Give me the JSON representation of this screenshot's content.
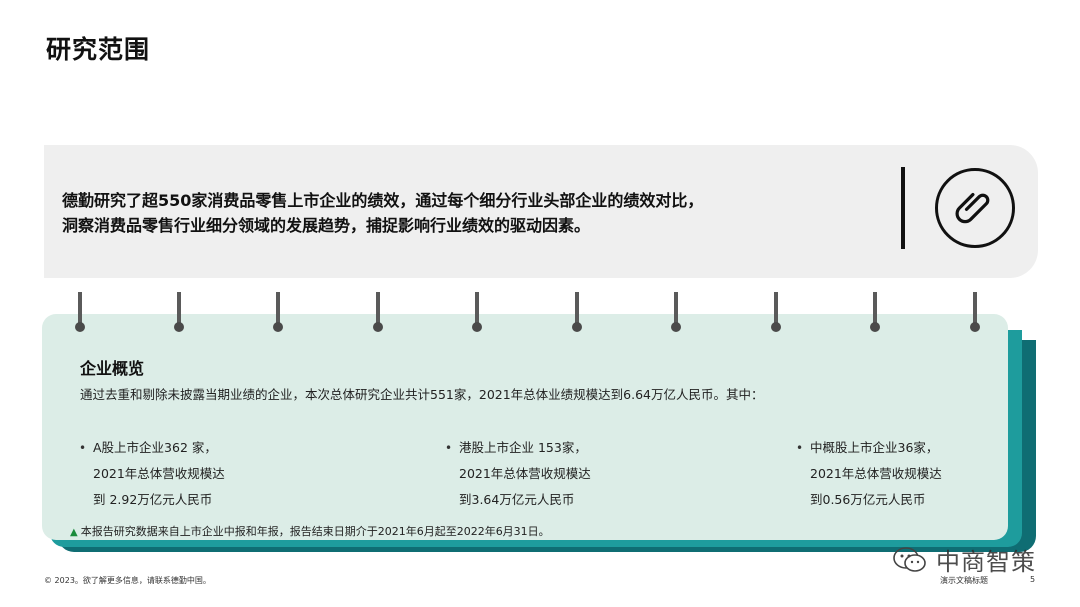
{
  "page": {
    "title": "研究范围"
  },
  "summary": {
    "line1": "德勤研究了超550家消费品零售上市企业的绩效，通过每个细分行业头部企业的绩效对比，",
    "line2": "洞察消费品零售行业细分领域的发展趋势，捕捉影响行业绩效的驱动因素。",
    "icon": "paperclip-icon"
  },
  "overview": {
    "title": "企业概览",
    "description": "通过去重和剔除未披露当期业绩的企业，本次总体研究企业共计551家，2021年总体业绩规模达到6.64万亿人民币。其中：",
    "columns": [
      {
        "bullet": "•",
        "line1": "A股上市企业362 家，",
        "line2": "2021年总体营收规模达",
        "line3": "到 2.92万亿元人民币"
      },
      {
        "bullet": "•",
        "line1": "港股上市企业 153家，",
        "line2": "2021年总体营收规模达",
        "line3": "到3.64万亿元人民币"
      },
      {
        "bullet": "•",
        "line1": "中概股上市企业36家，",
        "line2": "2021年总体营收规模达",
        "line3": "到0.56万亿元人民币"
      }
    ],
    "note_marker": "▲",
    "note": "本报告研究数据来自上市企业中报和年报，报告结束日期介于2021年6月起至2022年6月31日。"
  },
  "footer": {
    "copyright": "© 2023。欲了解更多信息，请联系德勤中国。",
    "center": "演示文稿标题",
    "page_number": "5"
  },
  "watermark": {
    "text": "中商智策",
    "icon": "wechat-icon"
  },
  "colors": {
    "card_gray": "#efefef",
    "card_mint": "#dcede7",
    "teal_mid": "#1e9c9d",
    "teal_dark": "#0f6d73",
    "accent_green": "#1a8c3c"
  }
}
